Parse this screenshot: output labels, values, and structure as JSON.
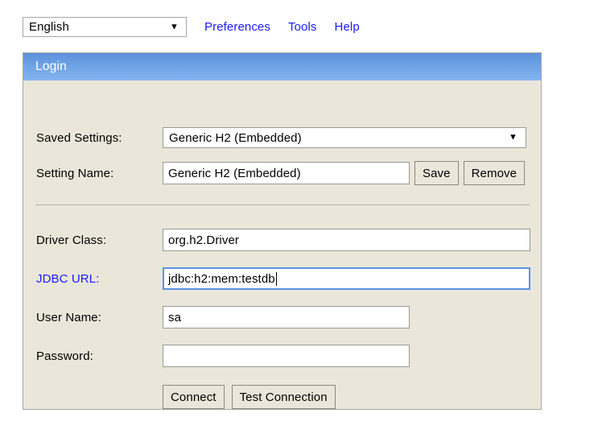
{
  "toolbar": {
    "language_select": {
      "value": "English",
      "arrow_icon": "▼"
    },
    "links": [
      {
        "label": "Preferences",
        "name": "preferences-link"
      },
      {
        "label": "Tools",
        "name": "tools-link"
      },
      {
        "label": "Help",
        "name": "help-link"
      }
    ],
    "link_color": "#1a1aff"
  },
  "panel": {
    "header_title": "Login",
    "header_color_top": "#5c90d9",
    "header_color_bottom": "#84b4f0",
    "background_color": "#eae7da"
  },
  "form": {
    "saved_settings": {
      "label": "Saved Settings:",
      "value": "Generic H2 (Embedded)",
      "arrow_icon": "▼"
    },
    "setting_name": {
      "label": "Setting Name:",
      "value": "Generic H2 (Embedded)",
      "placeholder": ""
    },
    "save_button": "Save",
    "remove_button": "Remove",
    "driver_class": {
      "label": "Driver Class:",
      "value": "org.h2.Driver",
      "placeholder": ""
    },
    "jdbc_url": {
      "label": "JDBC URL:",
      "value": "jdbc:h2:mem:testdb",
      "placeholder": "",
      "focused": true,
      "label_color": "#1a1aff"
    },
    "user_name": {
      "label": "User Name:",
      "value": "sa",
      "placeholder": ""
    },
    "password": {
      "label": "Password:",
      "value": "",
      "placeholder": ""
    },
    "connect_button": "Connect",
    "test_connection_button": "Test Connection"
  }
}
